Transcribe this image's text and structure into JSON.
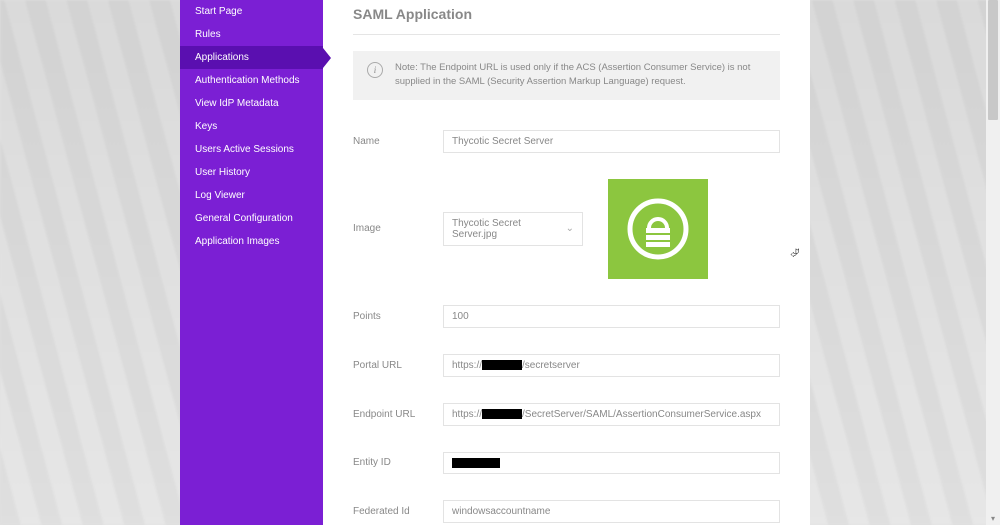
{
  "sidebar": {
    "items": [
      {
        "label": "Start Page",
        "active": false
      },
      {
        "label": "Rules",
        "active": false
      },
      {
        "label": "Applications",
        "active": true
      },
      {
        "label": "Authentication Methods",
        "active": false
      },
      {
        "label": "View IdP Metadata",
        "active": false
      },
      {
        "label": "Keys",
        "active": false
      },
      {
        "label": "Users Active Sessions",
        "active": false
      },
      {
        "label": "User History",
        "active": false
      },
      {
        "label": "Log Viewer",
        "active": false
      },
      {
        "label": "General Configuration",
        "active": false
      },
      {
        "label": "Application Images",
        "active": false
      }
    ]
  },
  "page": {
    "title": "SAML Application"
  },
  "note": {
    "text": "Note: The Endpoint URL is used only if the ACS (Assertion Consumer Service) is not supplied in the SAML (Security Assertion Markup Language) request."
  },
  "form": {
    "name_label": "Name",
    "name_value": "Thycotic Secret Server",
    "image_label": "Image",
    "image_select_value": "Thycotic Secret Server.jpg",
    "points_label": "Points",
    "points_value": "100",
    "portal_url_label": "Portal URL",
    "portal_url_prefix": "https://",
    "portal_url_suffix": "/secretserver",
    "endpoint_url_label": "Endpoint URL",
    "endpoint_url_prefix": "https://",
    "endpoint_url_suffix": "/SecretServer/SAML/AssertionConsumerService.aspx",
    "entity_id_label": "Entity ID",
    "entity_id_value": "",
    "federated_id_label": "Federated Id",
    "federated_id_value": "windowsaccountname"
  },
  "colors": {
    "sidebar": "#7b1fd4",
    "sidebar_active": "#5a0fb0",
    "preview_bg": "#8cc63f"
  }
}
